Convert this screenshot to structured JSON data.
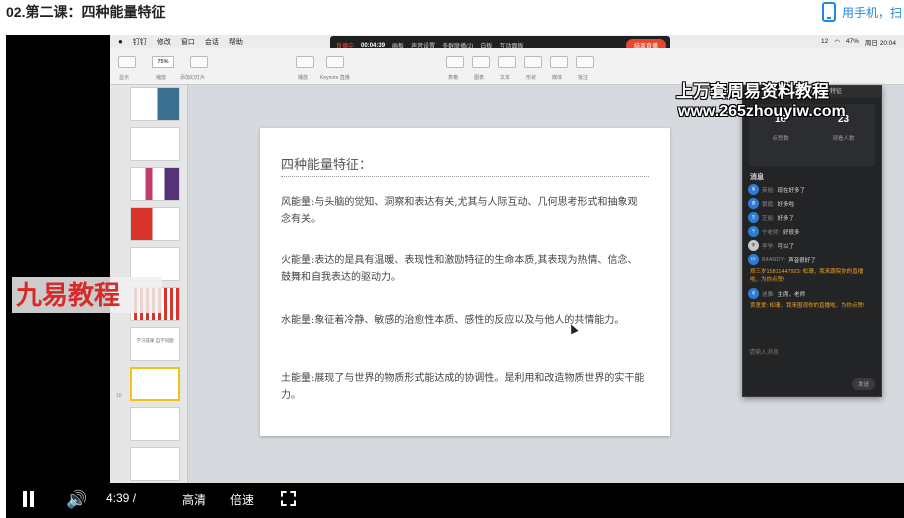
{
  "page": {
    "title": "02.第二课：四种能量特征",
    "phone_link": "用手机，扫"
  },
  "mac": {
    "menu": [
      "钉钉",
      "修改",
      "窗口",
      "会话",
      "帮助"
    ],
    "status": [
      "12",
      "47%",
      "周日 20:04"
    ]
  },
  "live_bar": {
    "status": "直播中",
    "timer": "00:04:39",
    "items": [
      "画板",
      "声音设置",
      "多群联播(2)",
      "白板",
      "互动面板"
    ],
    "end_label": "结束直播"
  },
  "keynote": {
    "zoom": "75%",
    "labels": [
      "显示",
      "缩放",
      "添加幻灯片",
      "播放",
      "Keynote 直播",
      "表格",
      "图表",
      "文本",
      "形状",
      "媒体",
      "批注"
    ]
  },
  "slides": {
    "thumb_title": "学习成果 自学问题",
    "active_index": "10"
  },
  "slide": {
    "heading": "四种能量特征：",
    "paragraphs": [
      "风能量:与头脑的觉知、洞察和表达有关,尤其与人际互动、几何思考形式和抽象观念有关。",
      "火能量:表达的是具有温暖、表现性和激励特征的生命本质,其表现为热情、信念、鼓舞和自我表达的驱动力。",
      "水能量:象征着冷静、敏感的治愈性本质、感性的反应以及与他人的共情能力。",
      "土能量:展现了与世界的物质形式能达成的协调性。是利用和改造物质世界的实干能力。"
    ]
  },
  "live_panel": {
    "title": "第二课：四种能量特征",
    "stats": [
      {
        "value": "16",
        "label": "点赞数"
      },
      {
        "value": "23",
        "label": "观看人数"
      }
    ],
    "messages_heading": "消息",
    "messages": [
      {
        "avatar": "英",
        "name": "英姐:",
        "text": "现在好多了"
      },
      {
        "avatar": "银",
        "name": "银霞:",
        "text": "好多啦"
      },
      {
        "avatar": "芝",
        "name": "芝姐:",
        "text": "好多了"
      },
      {
        "avatar": "宁",
        "name": "宁老师:",
        "text": "好很多"
      },
      {
        "avatar": "李",
        "name": "李学:",
        "text": "可以了"
      },
      {
        "avatar": "DY",
        "name": "B4ANDY:",
        "text": "声音很好了"
      }
    ],
    "notice1": "郑三岁15811447923: 松珊，我来跟院你的直播啦，为你点赞!",
    "msg_after": {
      "avatar": "老",
      "name": "迷雅:",
      "text": "主席，老师"
    },
    "notice2": "贾意爱: 松珊，我来围观你的直播啦，为你点赞!",
    "input_placeholder": "请输入消息",
    "send_label": "发送"
  },
  "watermarks": {
    "top": "上万套周易资料教程",
    "url": "www.265zhouyiw.com",
    "left": "九易教程"
  },
  "player": {
    "time": "4:39 /",
    "quality": "高清",
    "speed": "倍速"
  },
  "colors": {
    "accent_red": "#e8472b",
    "link_blue": "#1e88e5",
    "selection_yellow": "#f2c21b",
    "notice_orange": "#f0a020"
  }
}
